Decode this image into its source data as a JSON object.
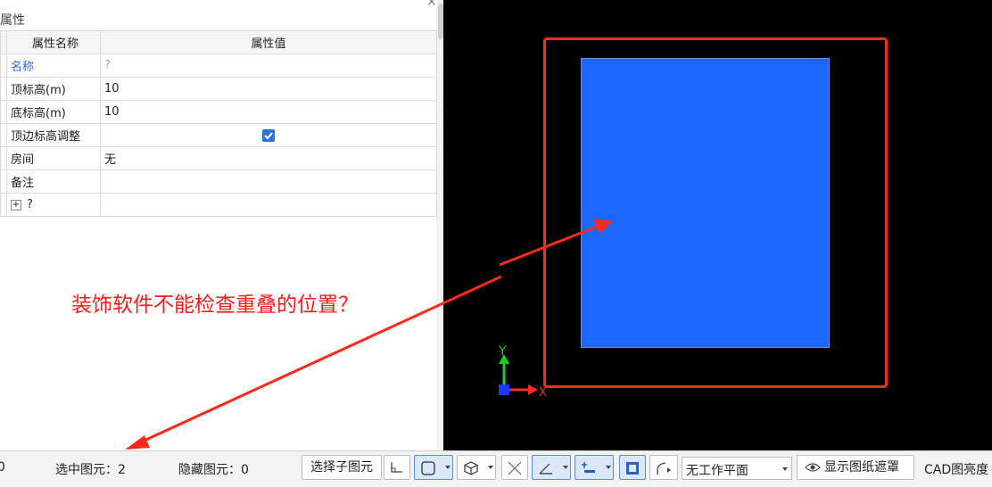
{
  "panel": {
    "title": "属性",
    "close": "×",
    "columns": [
      "属性名称",
      "属性值"
    ],
    "rows": [
      {
        "name": "名称",
        "value": "?"
      },
      {
        "name": "顶标高(m)",
        "value": "10"
      },
      {
        "name": "底标高(m)",
        "value": "10"
      },
      {
        "name": "顶边标高调整",
        "value": "",
        "checked": true
      },
      {
        "name": "房间",
        "value": "无"
      },
      {
        "name": "备注",
        "value": ""
      },
      {
        "name": "?",
        "value": "",
        "expandable": true
      }
    ]
  },
  "canvas": {
    "frame_color": "#ff2a1a",
    "fill_color": "#1f66ff",
    "axis_y": "Y",
    "axis_x": "X"
  },
  "annotation": {
    "text": "装饰软件不能检查重叠的位置？",
    "color": "#ff1a1a"
  },
  "status": {
    "left_cut": "0",
    "selected": "选中图元：2",
    "hidden": "隐藏图元：0",
    "select_child": "选择子图元",
    "workplane": "无工作平面",
    "show_mask": "显示图纸遮罩",
    "cad_brightness": "CAD图亮度"
  },
  "icons": [
    "checkbox-checked-icon",
    "plus-box-icon",
    "corner-icon",
    "box-select-icon",
    "cube-icon",
    "cross-icon",
    "angle-icon",
    "level-icon",
    "screen-icon",
    "curve-icon",
    "eye-icon",
    "axis-icon"
  ]
}
